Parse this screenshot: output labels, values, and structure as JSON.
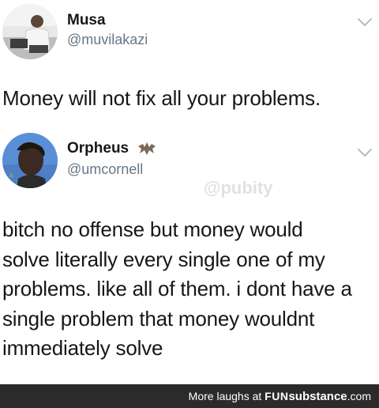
{
  "tweets": [
    {
      "name": "Musa",
      "handle": "@muvilakazi",
      "text": "Money will not fix all your problems."
    },
    {
      "name": "Orpheus",
      "handle": "@umcornell",
      "name_emoji_icon": "bat-icon",
      "text_lines": [
        "bitch no offense but money would",
        "solve literally every single one of my",
        "problems. like all of them. i dont have a",
        "single problem that money wouldnt",
        "immediately solve"
      ]
    }
  ],
  "watermark": "@pubity",
  "footer": {
    "prefix": "More laughs at",
    "brand_part1": "FUN",
    "brand_part2": "substance",
    "brand_part3": ".com"
  },
  "colors": {
    "text": "#14171a",
    "handle": "#657786",
    "footer_bg": "#2b2b2b"
  }
}
